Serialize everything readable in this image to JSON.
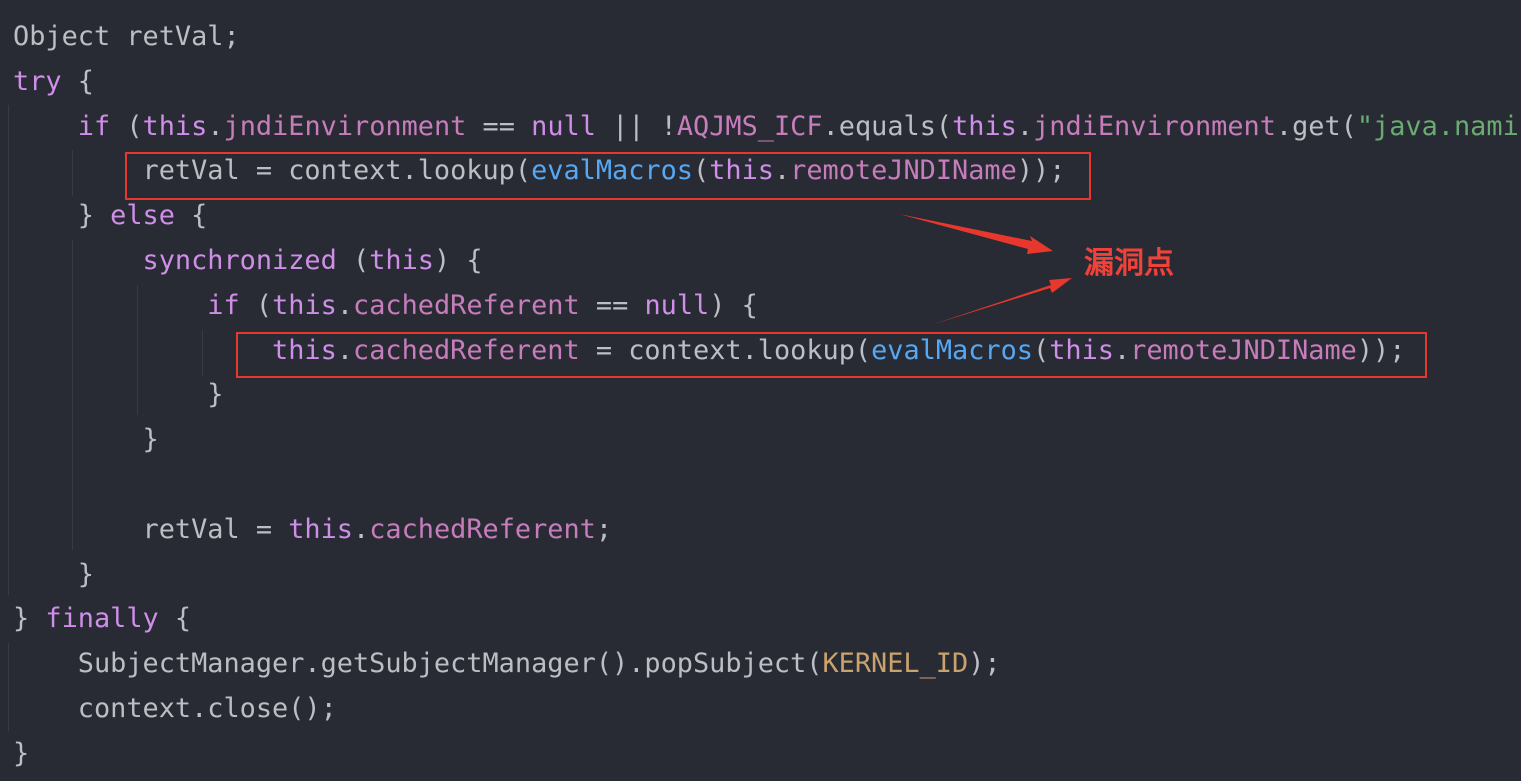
{
  "code_lines": [
    [
      [
        "pl",
        "Object retVal;"
      ]
    ],
    [
      [
        "kw",
        "try"
      ],
      [
        "pl",
        " {"
      ]
    ],
    [
      [
        "pl",
        "    "
      ],
      [
        "kw",
        "if"
      ],
      [
        "pl",
        " ("
      ],
      [
        "kw",
        "this"
      ],
      [
        "pl",
        "."
      ],
      [
        "fld",
        "jndiEnvironment"
      ],
      [
        "pl",
        " == "
      ],
      [
        "kw",
        "null"
      ],
      [
        "pl",
        " || !"
      ],
      [
        "cst",
        "AQJMS_ICF"
      ],
      [
        "pl",
        ".equals("
      ],
      [
        "kw",
        "this"
      ],
      [
        "pl",
        "."
      ],
      [
        "fld",
        "jndiEnvironment"
      ],
      [
        "pl",
        ".get("
      ],
      [
        "str",
        "\"java.naming"
      ]
    ],
    [
      [
        "pl",
        "        retVal = context.lookup("
      ],
      [
        "fn",
        "evalMacros"
      ],
      [
        "pl",
        "("
      ],
      [
        "kw",
        "this"
      ],
      [
        "pl",
        "."
      ],
      [
        "fld",
        "remoteJNDIName"
      ],
      [
        "pl",
        "));"
      ]
    ],
    [
      [
        "pl",
        "    } "
      ],
      [
        "kw",
        "else"
      ],
      [
        "pl",
        " {"
      ]
    ],
    [
      [
        "pl",
        "        "
      ],
      [
        "kw",
        "synchronized"
      ],
      [
        "pl",
        " ("
      ],
      [
        "kw",
        "this"
      ],
      [
        "pl",
        ") {"
      ]
    ],
    [
      [
        "pl",
        "            "
      ],
      [
        "kw",
        "if"
      ],
      [
        "pl",
        " ("
      ],
      [
        "kw",
        "this"
      ],
      [
        "pl",
        "."
      ],
      [
        "fld",
        "cachedReferent"
      ],
      [
        "pl",
        " == "
      ],
      [
        "kw",
        "null"
      ],
      [
        "pl",
        ") {"
      ]
    ],
    [
      [
        "pl",
        "                "
      ],
      [
        "kw",
        "this"
      ],
      [
        "pl",
        "."
      ],
      [
        "fld",
        "cachedReferent"
      ],
      [
        "pl",
        " = context.lookup("
      ],
      [
        "fn",
        "evalMacros"
      ],
      [
        "pl",
        "("
      ],
      [
        "kw",
        "this"
      ],
      [
        "pl",
        "."
      ],
      [
        "fld",
        "remoteJNDIName"
      ],
      [
        "pl",
        "));"
      ]
    ],
    [
      [
        "pl",
        "            }"
      ]
    ],
    [
      [
        "pl",
        "        }"
      ]
    ],
    [
      [
        "pl",
        ""
      ]
    ],
    [
      [
        "pl",
        "        retVal = "
      ],
      [
        "kw",
        "this"
      ],
      [
        "pl",
        "."
      ],
      [
        "fld",
        "cachedReferent"
      ],
      [
        "pl",
        ";"
      ]
    ],
    [
      [
        "pl",
        "    }"
      ]
    ],
    [
      [
        "pl",
        "} "
      ],
      [
        "kw",
        "finally"
      ],
      [
        "pl",
        " {"
      ]
    ],
    [
      [
        "pl",
        "    SubjectManager.getSubjectManager().popSubject("
      ],
      [
        "kid",
        "KERNEL_ID"
      ],
      [
        "pl",
        ");"
      ]
    ],
    [
      [
        "pl",
        "    context.close();"
      ]
    ],
    [
      [
        "pl",
        "}"
      ]
    ]
  ],
  "annotation": {
    "label": "漏洞点"
  },
  "colors": {
    "background": "#282b33",
    "keyword": "#cf8ee8",
    "field": "#c77dbb",
    "function": "#56a8f5",
    "string": "#6aab73",
    "constant_id": "#c9a26d",
    "plain": "#bcbec4",
    "highlight": "#e8382e"
  }
}
